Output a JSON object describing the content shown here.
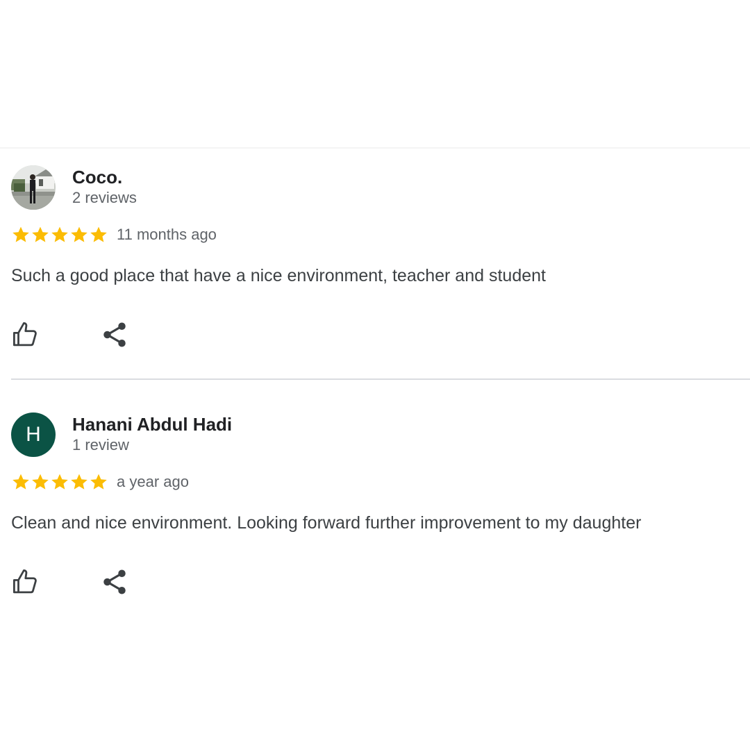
{
  "colors": {
    "star": "#fbbc04",
    "name": "#202124",
    "meta": "#5f6368",
    "body": "#3c4043",
    "icon": "#3c4043",
    "avatar_letter_bg": "#0b5345",
    "separator": "#dadce0"
  },
  "reviews": [
    {
      "author": "Coco.",
      "meta": "2 reviews",
      "avatar": {
        "type": "photo"
      },
      "stars": 5,
      "date": "11 months ago",
      "text": "Such a good place that have a nice environment, teacher and student",
      "icons": {
        "like": "thumbs-up-icon",
        "share": "share-icon"
      }
    },
    {
      "author": "Hanani Abdul Hadi",
      "meta": "1 review",
      "avatar": {
        "type": "letter",
        "letter": "H"
      },
      "stars": 5,
      "date": "a year ago",
      "text": "Clean and nice environment. Looking forward further improvement to my daughter",
      "icons": {
        "like": "thumbs-up-icon",
        "share": "share-icon"
      }
    }
  ]
}
